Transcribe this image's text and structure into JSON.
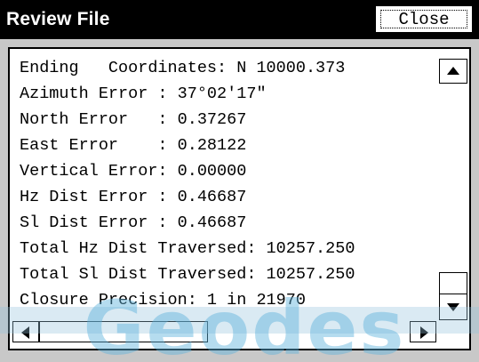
{
  "window": {
    "title": "Review File",
    "close_label": "Close"
  },
  "content": {
    "lines": [
      "Ending   Coordinates: N 10000.373",
      "Azimuth Error : 37°02'17\"",
      "North Error   : 0.37267",
      "East Error    : 0.28122",
      "Vertical Error: 0.00000",
      "Hz Dist Error : 0.46687",
      "Sl Dist Error : 0.46687",
      "Total Hz Dist Traversed: 10257.250",
      "Total Sl Dist Traversed: 10257.250",
      "Closure Precision: 1 in 21970"
    ]
  },
  "watermark": {
    "text": "Geodes",
    "color": "#5ab2dc"
  },
  "colors": {
    "titlebar": "#000000",
    "title_text": "#ffffff",
    "window_bg": "#c8c8c8"
  },
  "icons": {
    "scroll_up": "triangle-up-icon",
    "scroll_down": "triangle-down-icon",
    "scroll_left": "triangle-left-icon",
    "scroll_right": "triangle-right-icon"
  }
}
